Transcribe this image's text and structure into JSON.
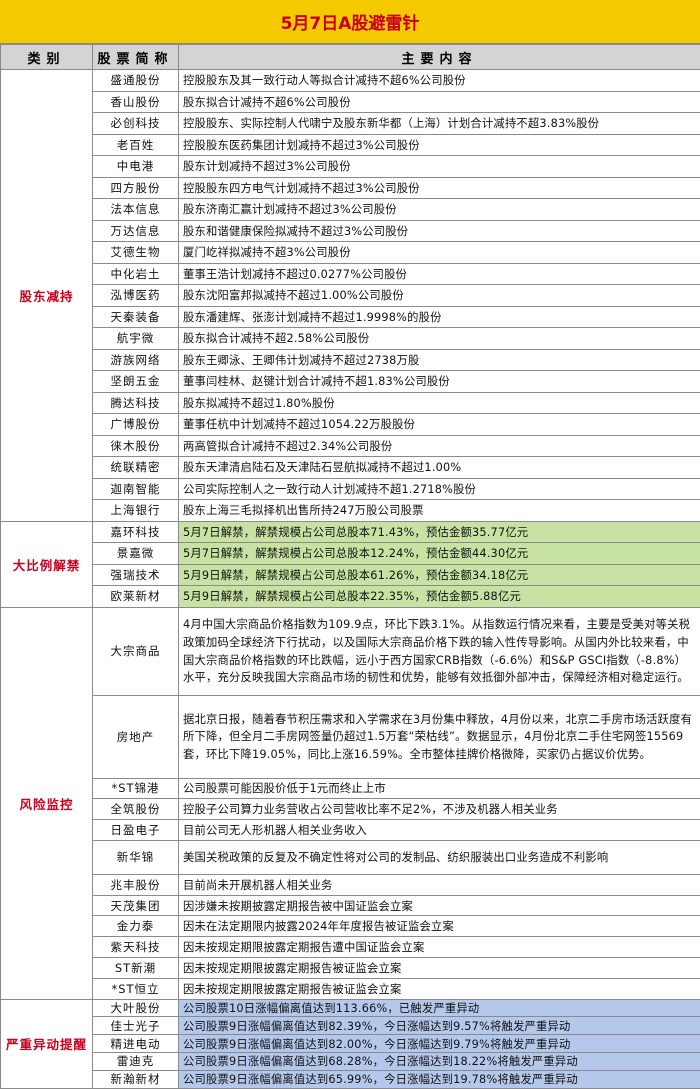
{
  "title": "5月7日A股避雷针",
  "headers": {
    "category": "类别",
    "stock": "股票简称",
    "content": "主要内容"
  },
  "sections": [
    {
      "category": "股东减持",
      "rows": [
        {
          "name": "盛通股份",
          "content": "控股股东及其一致行动人等拟合计减持不超6%公司股份"
        },
        {
          "name": "香山股份",
          "content": "股东拟合计减持不超6%公司股份"
        },
        {
          "name": "必创科技",
          "content": "控股股东、实际控制人代啸宁及股东新华都（上海）计划合计减持不超3.83%股份"
        },
        {
          "name": "老百姓",
          "content": "控股股东医药集团计划减持不超过3%公司股份"
        },
        {
          "name": "中电港",
          "content": "股东计划减持不超过3%公司股份"
        },
        {
          "name": "四方股份",
          "content": "控股股东四方电气计划减持不超过3%公司股份"
        },
        {
          "name": "法本信息",
          "content": "股东济南汇赢计划减持不超过3%公司股份"
        },
        {
          "name": "万达信息",
          "content": "股东和谐健康保险拟减持不超过3%公司股份"
        },
        {
          "name": "艾德生物",
          "content": "厦门屹祥拟减持不超3%公司股份"
        },
        {
          "name": "中化岩土",
          "content": "董事王浩计划减持不超过0.0277%公司股份"
        },
        {
          "name": "泓博医药",
          "content": "股东沈阳富邦拟减持不超过1.00%公司股份"
        },
        {
          "name": "天秦装备",
          "content": "股东潘建辉、张澎计划减持不超过1.9998%的股份"
        },
        {
          "name": "航宇微",
          "content": "股东拟合计减持不超2.58%公司股份"
        },
        {
          "name": "游族网络",
          "content": "股东王卿泳、王卿伟计划减持不超过2738万股"
        },
        {
          "name": "坚朗五金",
          "content": "董事闫桂林、赵键计划合计减持不超1.83%公司股份"
        },
        {
          "name": "腾达科技",
          "content": "股东拟减持不超过1.80%股份"
        },
        {
          "name": "广博股份",
          "content": "董事任杭中计划减持不超过1054.22万股股份"
        },
        {
          "name": "徕木股份",
          "content": "两高管拟合计减持不超过2.34%公司股份"
        },
        {
          "name": "统联精密",
          "content": "股东天津清启陆石及天津陆石昱航拟减持不超过1.00%"
        },
        {
          "name": "迦南智能",
          "content": "公司实际控制人之一致行动人计划减持不超1.2718%股份"
        },
        {
          "name": "上海银行",
          "content": "股东上海三毛拟择机出售所持247万股公司股票"
        }
      ]
    },
    {
      "category": "大比例解禁",
      "rows": [
        {
          "name": "嘉环科技",
          "content": "5月7日解禁，解禁规模占公司总股本71.43%，预估金额35.77亿元"
        },
        {
          "name": "景嘉微",
          "content": "5月7日解禁，解禁规模占公司总股本12.24%，预估金额44.30亿元"
        },
        {
          "name": "强瑞技术",
          "content": "5月9日解禁，解禁规模占公司总股本61.26%，预估金额34.18亿元"
        },
        {
          "name": "欧莱新材",
          "content": "5月9日解禁，解禁规模占公司总股本22.35%，预估金额5.88亿元"
        }
      ]
    },
    {
      "category": "风险监控",
      "rows": [
        {
          "name": "大宗商品",
          "content": "4月中国大宗商品价格指数为109.9点，环比下跌3.1%。从指数运行情况来看，主要是受美对等关税政策加码全球经济下行扰动，以及国际大宗商品价格下跌的输入性传导影响。从国内外比较来看，中国大宗商品价格指数的环比跌幅，远小于西方国家CRB指数（-6.6%）和S&P GSCI指数（-8.8%）水平，充分反映我国大宗商品市场的韧性和优势，能够有效抵御外部冲击，保障经济相对稳定运行。"
        },
        {
          "name": "房地产",
          "content": "据北京日报，随着春节积压需求和入学需求在3月份集中释放，4月份以来，北京二手房市场活跃度有所下降，但全月二手房网签量仍超过1.5万套“荣枯线”。数据显示，4月份北京二手住宅网签15569套，环比下降19.05%，同比上涨16.59%。全市整体挂牌价格微降，买家仍占据议价优势。"
        },
        {
          "name": "*ST锦港",
          "content": "公司股票可能因股价低于1元而终止上市"
        },
        {
          "name": "全筑股份",
          "content": "控股子公司算力业务营收占公司营收比率不足2%，不涉及机器人相关业务"
        },
        {
          "name": "日盈电子",
          "content": "目前公司无人形机器人相关业务收入"
        },
        {
          "name": "新华锦",
          "content": "美国关税政策的反复及不确定性将对公司的发制品、纺织服装出口业务造成不利影响"
        },
        {
          "name": "兆丰股份",
          "content": "目前尚未开展机器人相关业务"
        },
        {
          "name": "天茂集团",
          "content": "因涉嫌未按期披露定期报告被中国证监会立案"
        },
        {
          "name": "金力泰",
          "content": "因未在法定期限内披露2024年年度报告被证监会立案"
        },
        {
          "name": "紫天科技",
          "content": "因未按规定期限披露定期报告遭中国证监会立案"
        },
        {
          "name": "ST新潮",
          "content": "因未按规定期限披露定期报告被证监会立案"
        },
        {
          "name": "*ST恒立",
          "content": "因未按规定期限披露定期报告被证监会立案"
        }
      ]
    },
    {
      "category": "严重异动提醒",
      "rows": [
        {
          "name": "大叶股份",
          "content": "公司股票10日涨幅偏离值达到113.66%，已触发严重异动"
        },
        {
          "name": "佳士光子",
          "content": "公司股票9日涨幅偏离值达到82.39%，今日涨幅达到9.57%将触发严重异动"
        },
        {
          "name": "精进电动",
          "content": "公司股票9日涨幅偏离值达到82.00%，今日涨幅达到9.79%将触发严重异动"
        },
        {
          "name": "雷迪克",
          "content": "公司股票9日涨幅偏离值达到68.28%，今日涨幅达到18.22%将触发严重异动"
        },
        {
          "name": "新瀚新材",
          "content": "公司股票9日涨幅偏离值达到65.99%，今日涨幅达到19.78%将触发严重异动"
        }
      ]
    }
  ]
}
